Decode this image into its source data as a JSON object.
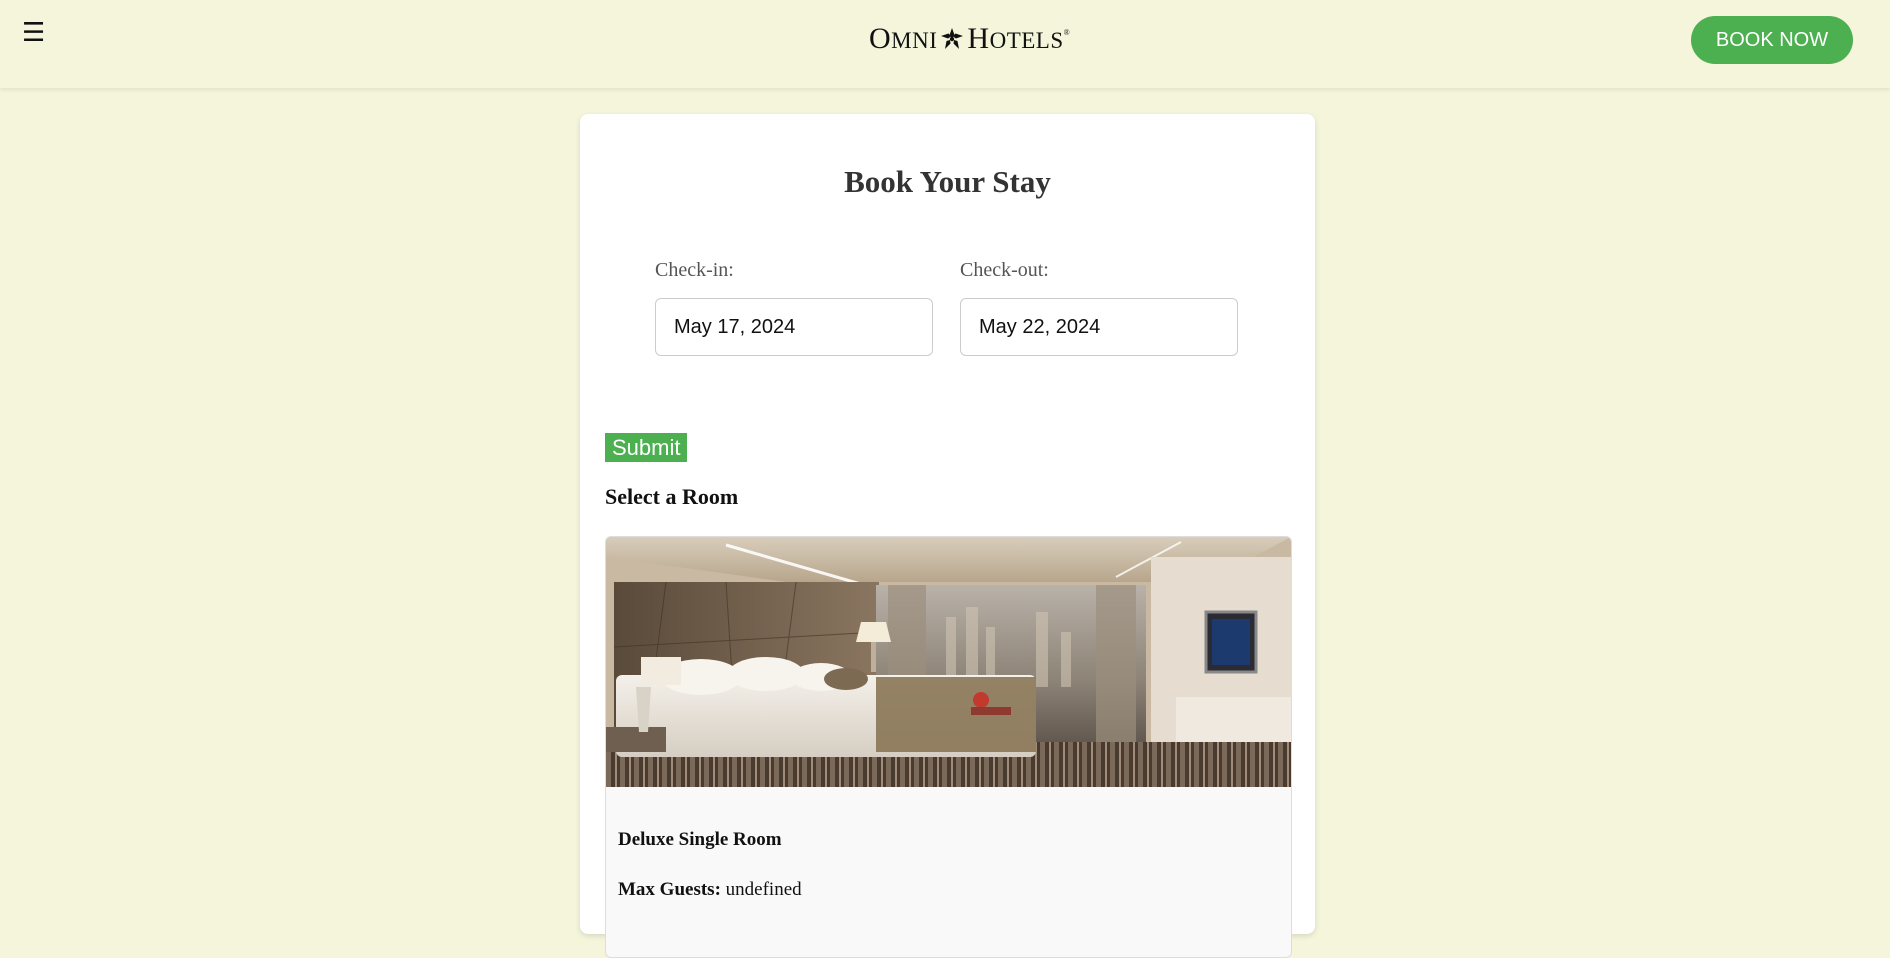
{
  "header": {
    "menu_icon": "☰",
    "logo": {
      "text": "OMNI HOTELS"
    },
    "book_now_label": "BOOK NOW"
  },
  "booking": {
    "title": "Book Your Stay",
    "checkin_label": "Check-in:",
    "checkin_value": "May 17, 2024",
    "checkout_label": "Check-out:",
    "checkout_value": "May 22, 2024",
    "submit_label": "Submit"
  },
  "rooms": {
    "section_title": "Select a Room",
    "items": [
      {
        "name": "Deluxe Single Room",
        "max_guests_label": "Max Guests:",
        "max_guests_value": "undefined",
        "photo": "hotel-room-photo"
      }
    ]
  },
  "colors": {
    "background": "#f5f5dc",
    "accent": "#4caf50",
    "card": "#ffffff"
  }
}
